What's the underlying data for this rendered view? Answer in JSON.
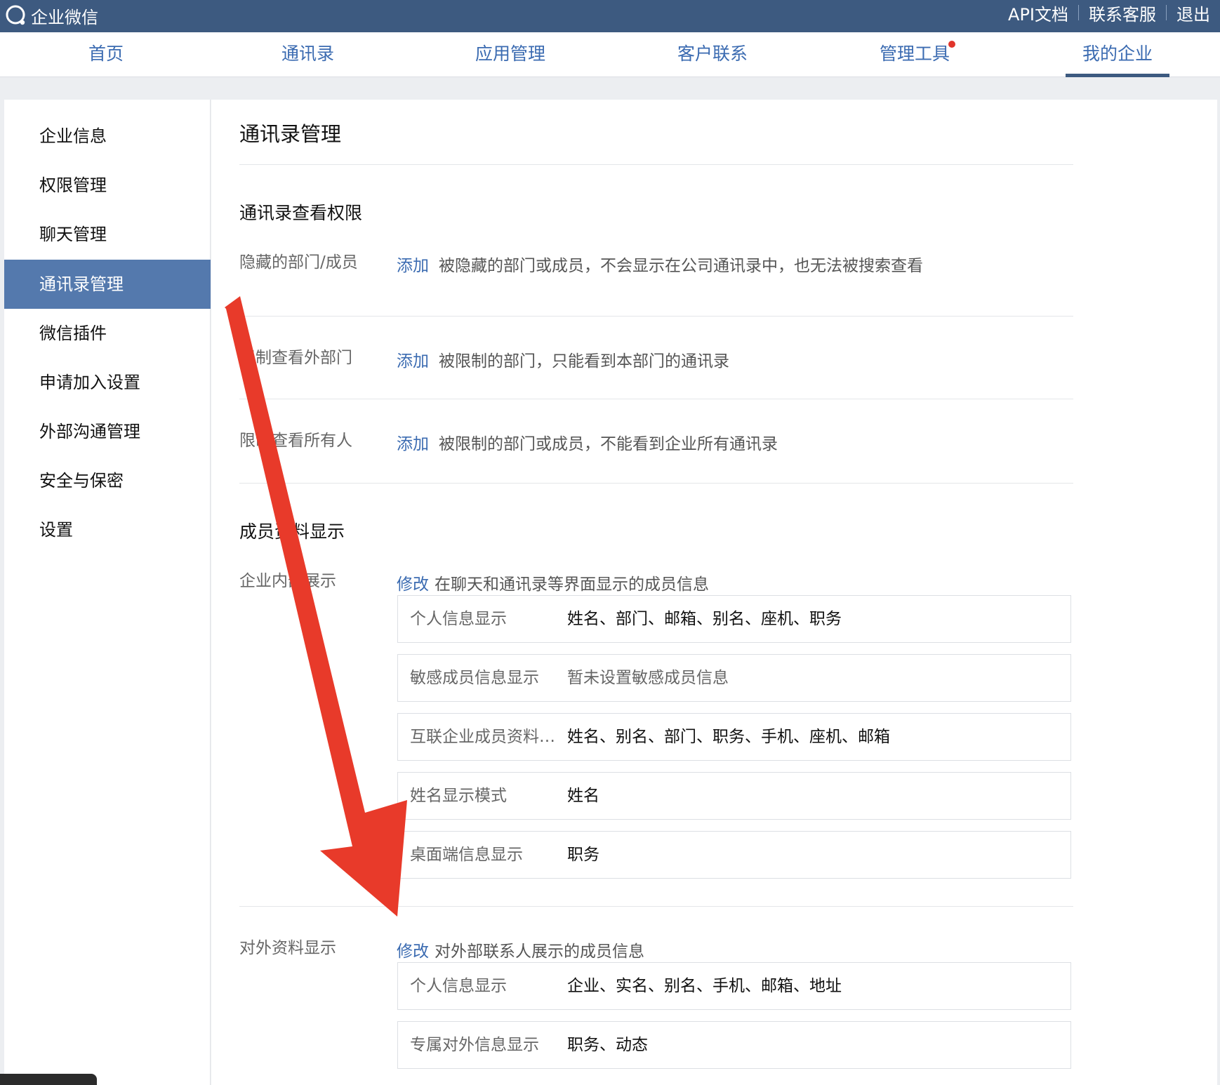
{
  "topbar": {
    "logo_text": "企业微信",
    "links": [
      "API文档",
      "联系客服",
      "退出"
    ]
  },
  "nav": {
    "items": [
      "首页",
      "通讯录",
      "应用管理",
      "客户联系",
      "管理工具",
      "我的企业"
    ],
    "active": "我的企业"
  },
  "sidebar": {
    "items": [
      "企业信息",
      "权限管理",
      "聊天管理",
      "通讯录管理",
      "微信插件",
      "申请加入设置",
      "外部沟通管理",
      "安全与保密",
      "设置"
    ],
    "active": "通讯录管理"
  },
  "main": {
    "title": "通讯录管理",
    "view_permission": {
      "title": "通讯录查看权限",
      "rows": [
        {
          "label": "隐藏的部门/成员",
          "action": "添加",
          "desc": "被隐藏的部门或成员，不会显示在公司通讯录中，也无法被搜索查看"
        },
        {
          "label": "限制查看外部门",
          "action": "添加",
          "desc": "被限制的部门，只能看到本部门的通讯录"
        },
        {
          "label": "限制查看所有人",
          "action": "添加",
          "desc": "被限制的部门或成员，不能看到企业所有通讯录"
        }
      ]
    },
    "member_display": {
      "title": "成员资料显示",
      "internal": {
        "label": "企业内部展示",
        "action": "修改",
        "desc": "在聊天和通讯录等界面显示的成员信息",
        "items": [
          {
            "key": "个人信息显示",
            "value": "姓名、部门、邮箱、别名、座机、职务"
          },
          {
            "key": "敏感成员信息显示",
            "value": "暂未设置敏感成员信息"
          },
          {
            "key": "互联企业成员资料…",
            "value": "姓名、别名、部门、职务、手机、座机、邮箱"
          },
          {
            "key": "姓名显示模式",
            "value": "姓名"
          },
          {
            "key": "桌面端信息显示",
            "value": "职务"
          }
        ]
      },
      "external": {
        "label": "对外资料显示",
        "action": "修改",
        "desc": "对外部联系人展示的成员信息",
        "items": [
          {
            "key": "个人信息显示",
            "value": "企业、实名、别名、手机、邮箱、地址"
          },
          {
            "key": "专属对外信息显示",
            "value": "职务、动态"
          }
        ]
      }
    }
  },
  "colors": {
    "topbar": "#3d5a80",
    "link": "#3b6bb1",
    "sidebar_active": "#5479ad",
    "annotation_arrow": "#e83a2a",
    "notification_dot": "#e1352b"
  }
}
